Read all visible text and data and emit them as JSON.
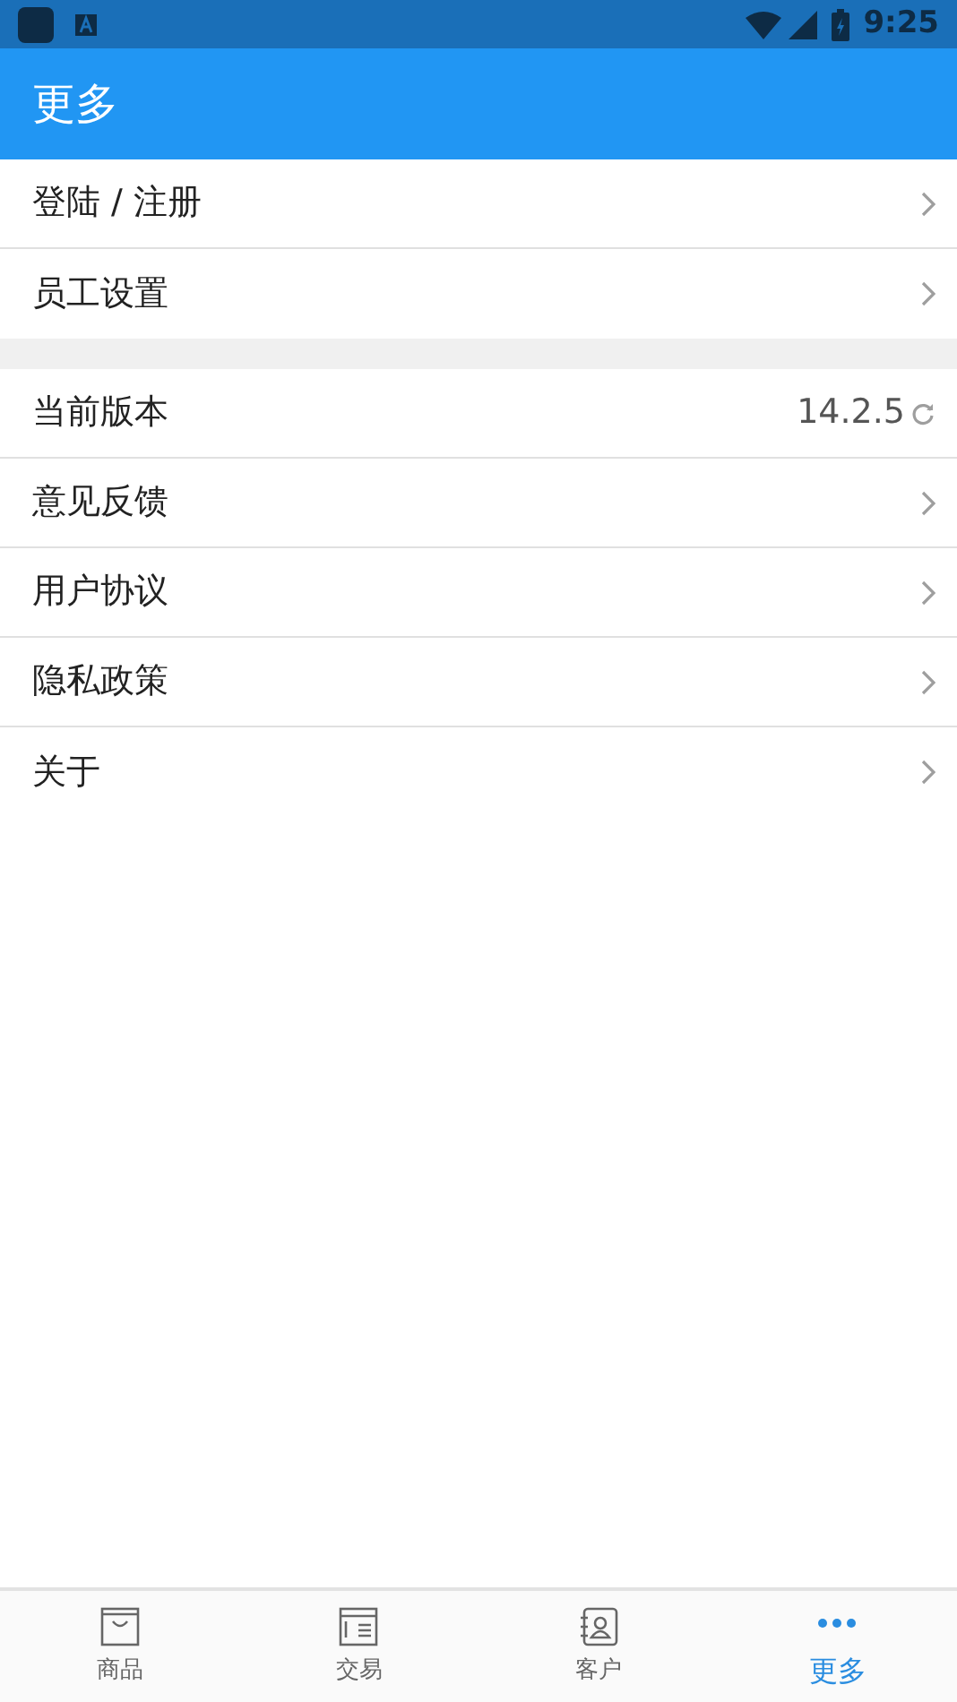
{
  "status_bar": {
    "time": "9:25"
  },
  "header": {
    "title": "更多"
  },
  "groups": [
    {
      "items": [
        {
          "kind": "link",
          "label": "登陆 / 注册"
        },
        {
          "kind": "link",
          "label": "员工设置"
        }
      ]
    },
    {
      "items": [
        {
          "kind": "version",
          "label": "当前版本",
          "value": "14.2.5"
        },
        {
          "kind": "link",
          "label": "意见反馈"
        },
        {
          "kind": "link",
          "label": "用户协议"
        },
        {
          "kind": "link",
          "label": "隐私政策"
        },
        {
          "kind": "link",
          "label": "关于"
        }
      ]
    }
  ],
  "tabs": [
    {
      "label": "商品",
      "kind": "bag",
      "selected": false
    },
    {
      "label": "交易",
      "kind": "bill",
      "selected": false
    },
    {
      "label": "客户",
      "kind": "contact",
      "selected": false
    },
    {
      "label": "更多",
      "kind": "dots",
      "selected": true
    }
  ]
}
